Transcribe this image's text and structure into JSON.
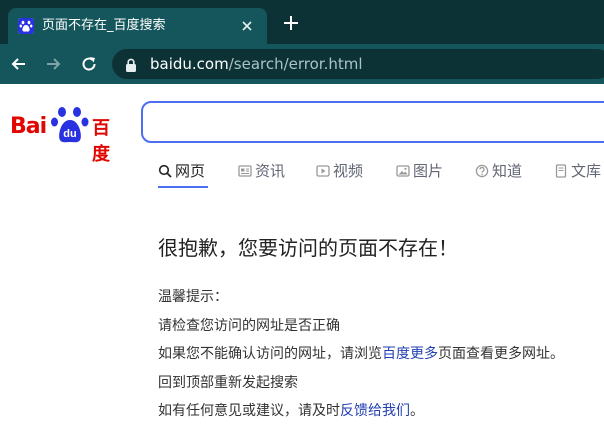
{
  "browser": {
    "tab": {
      "title": "页面不存在_百度搜索",
      "close_icon": "close-icon",
      "favicon": "baidu-paw-icon"
    },
    "new_tab_label": "+",
    "nav": {
      "back_icon": "arrow-left-icon",
      "forward_icon": "arrow-right-icon",
      "reload_icon": "reload-icon"
    },
    "address": {
      "host": "baidu.com",
      "path": "/search/error.html",
      "lock_icon": "lock-icon"
    }
  },
  "logo": {
    "text_left": "Bai",
    "text_paw": "du",
    "text_right": "百度"
  },
  "search": {
    "value": "",
    "placeholder": ""
  },
  "tabs": [
    {
      "label": "网页",
      "icon": "search-icon",
      "active": true
    },
    {
      "label": "资讯",
      "icon": "news-icon",
      "active": false
    },
    {
      "label": "视频",
      "icon": "video-icon",
      "active": false
    },
    {
      "label": "图片",
      "icon": "image-icon",
      "active": false
    },
    {
      "label": "知道",
      "icon": "question-icon",
      "active": false
    },
    {
      "label": "文库",
      "icon": "doc-icon",
      "active": false
    }
  ],
  "error": {
    "title": "很抱歉，您要访问的页面不存在！",
    "tips_heading": "温馨提示：",
    "line1": "请检查您访问的网址是否正确",
    "line2_pre": "如果您不能确认访问的网址，请浏览",
    "line2_link": "百度更多",
    "line2_post": "页面查看更多网址。",
    "line3": "回到顶部重新发起搜索",
    "line4_pre": "如有任何意见或建议，请及时",
    "line4_link": "反馈给我们",
    "line4_post": "。"
  },
  "colors": {
    "chrome_dark": "#0d3236",
    "chrome_tab": "#14565c",
    "accent": "#4e6ef2",
    "logo_red": "#e10601",
    "logo_blue": "#2932e1",
    "link": "#2440b3"
  }
}
